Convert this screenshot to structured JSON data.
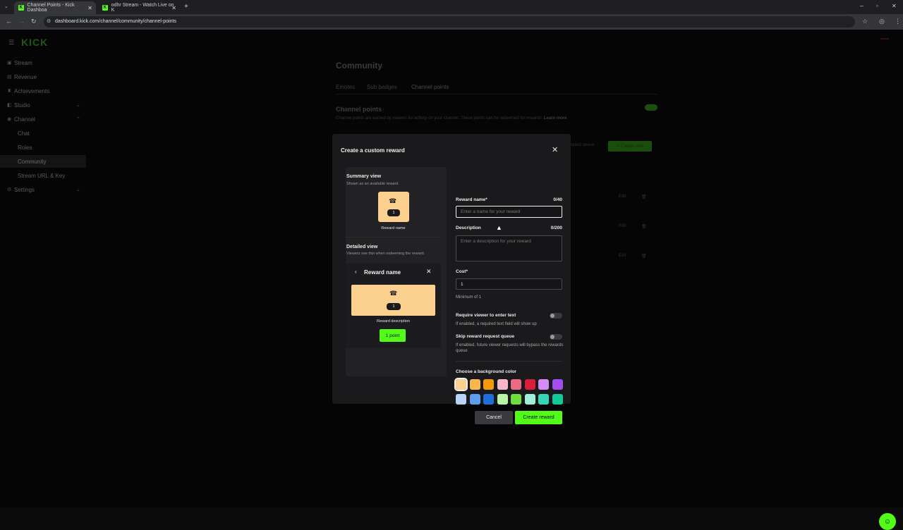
{
  "browser": {
    "tabs": [
      {
        "title": "Channel Points - Kick Dashboa",
        "active": true
      },
      {
        "title": "odhr Stream - Watch Live on K",
        "active": false
      }
    ],
    "url": "dashboard.kick.com/channel/community/channel-points"
  },
  "sidebar": {
    "logo": "KICK",
    "items": [
      {
        "label": "Stream"
      },
      {
        "label": "Revenue"
      },
      {
        "label": "Achievements"
      },
      {
        "label": "Studio"
      },
      {
        "label": "Channel"
      },
      {
        "label": "Chat"
      },
      {
        "label": "Roles"
      },
      {
        "label": "Community"
      },
      {
        "label": "Stream URL & Key"
      },
      {
        "label": "Settings"
      }
    ]
  },
  "page": {
    "title": "Community",
    "tabs": [
      "Emotes",
      "Sub badges",
      "Channel points"
    ],
    "section_title": "Channel points",
    "section_desc": "Channel points are earned by viewers for activity on your channel. These points can be redeemed for rewards.",
    "learn_more": "Learn more",
    "queue_label": "equest queue",
    "create_new": "Create new",
    "edit_label": "Edit"
  },
  "modal": {
    "title": "Create a custom reward",
    "summary_title": "Summary view",
    "summary_sub": "Shown as an available reward",
    "tile_cost": "1",
    "reward_name_label": "Reward name",
    "detailed_title": "Detailed view",
    "detailed_sub": "Viewers see this when redeeming the reward",
    "detail_card_title": "Reward name",
    "reward_description_label": "Reward description",
    "points_button": "1 point",
    "form": {
      "name_label": "Reward name*",
      "name_count": "0/40",
      "name_placeholder": "Enter a name for your reward",
      "desc_label": "Description",
      "desc_count": "0/200",
      "desc_placeholder": "Enter a description for your reward",
      "cost_label": "Cost*",
      "cost_value": "1",
      "cost_hint": "Minimum of 1",
      "require_text_label": "Require viewer to enter text",
      "require_text_hint": "If enabled, a required text field will show up",
      "skip_queue_label": "Skip reward request queue",
      "skip_queue_hint": "If enabled, future viewer requests will bypass the rewards queue",
      "bg_color_label": "Choose a background color"
    },
    "colors_row1": [
      "#fcd08f",
      "#f9b84e",
      "#f59a0b",
      "#f8b7c8",
      "#e86a85",
      "#d91e3c",
      "#d18cf5",
      "#a24df2"
    ],
    "colors_row2": [
      "#b9d2f5",
      "#5c9ded",
      "#1f6fdb",
      "#b8f5a8",
      "#6ddf3c",
      "#9ef0d9",
      "#35d6b6",
      "#13c99a"
    ],
    "cancel": "Cancel",
    "create": "Create reward"
  }
}
